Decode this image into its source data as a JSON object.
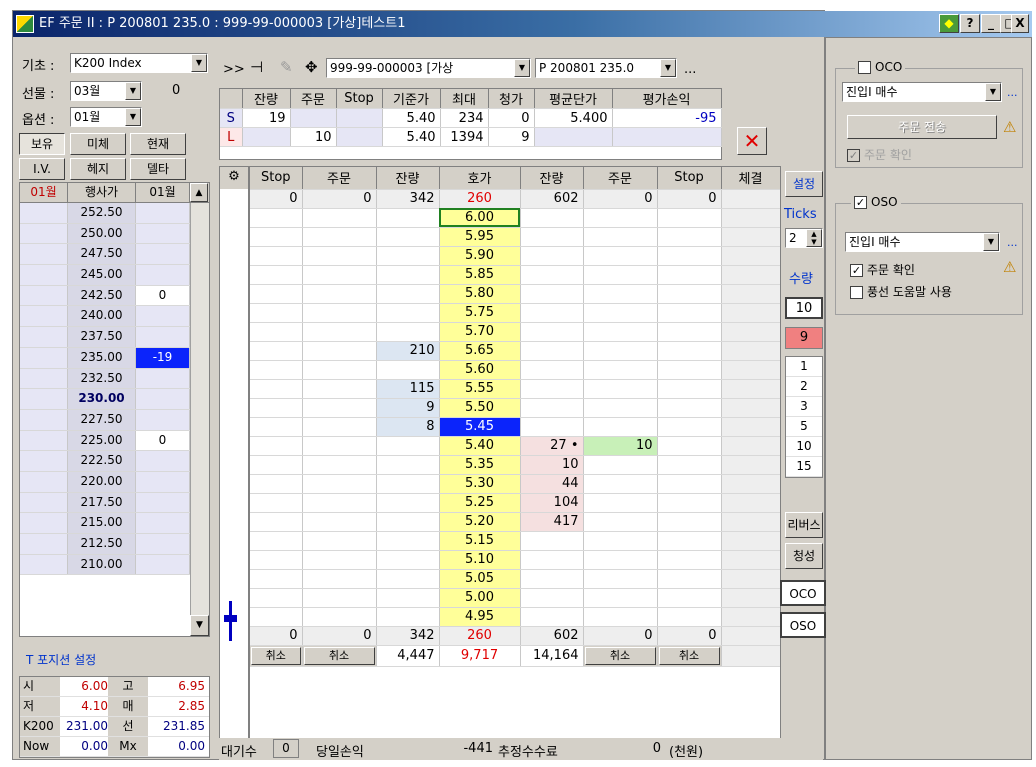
{
  "window": {
    "title": "EF 주문 II : P 200801 235.0 : 999-99-000003 [가상]테스트1",
    "buttons": [
      "?",
      "_",
      "□",
      "X"
    ]
  },
  "left": {
    "base_label": "기초 :",
    "base_value": "K200 Index",
    "futures_label": "선물 :",
    "futures_month": "03월",
    "futures_qty": "0",
    "option_label": "옵션 :",
    "option_month": "01월",
    "tabs1": [
      "보유",
      "미체",
      "현재"
    ],
    "tabs2": [
      "I.V.",
      "헤지",
      "델타"
    ],
    "col_headers": [
      "01월",
      "행사가",
      "01월"
    ],
    "strikes": [
      {
        "k": "252.50",
        "p": ""
      },
      {
        "k": "250.00",
        "p": ""
      },
      {
        "k": "247.50",
        "p": ""
      },
      {
        "k": "245.00",
        "p": ""
      },
      {
        "k": "242.50",
        "p": "0"
      },
      {
        "k": "240.00",
        "p": ""
      },
      {
        "k": "237.50",
        "p": ""
      },
      {
        "k": "235.00",
        "p": "-19"
      },
      {
        "k": "232.50",
        "p": ""
      },
      {
        "k": "230.00",
        "p": ""
      },
      {
        "k": "227.50",
        "p": ""
      },
      {
        "k": "225.00",
        "p": "0"
      },
      {
        "k": "222.50",
        "p": ""
      },
      {
        "k": "220.00",
        "p": ""
      },
      {
        "k": "217.50",
        "p": ""
      },
      {
        "k": "215.00",
        "p": ""
      },
      {
        "k": "212.50",
        "p": ""
      },
      {
        "k": "210.00",
        "p": ""
      }
    ],
    "position_setting": "T 포지션 설정",
    "stats": [
      {
        "a": "시",
        "b": "6.00",
        "c": "고",
        "d": "6.95"
      },
      {
        "a": "저",
        "b": "4.10",
        "c": "매",
        "d": "2.85"
      },
      {
        "a": "K200",
        "b": "231.00",
        "c": "선",
        "d": "231.85"
      },
      {
        "a": "Now",
        "b": "0.00",
        "c": "Mx",
        "d": "0.00"
      }
    ]
  },
  "toolbar": {
    "nav": ">>",
    "account": "999-99-000003 [가상",
    "symbol": "P 200801 235.0",
    "more": "..."
  },
  "summary": {
    "headers": [
      "잔량",
      "주문",
      "Stop",
      "기준가",
      "최대",
      "청가",
      "평균단가",
      "평가손익"
    ],
    "s": {
      "label": "S",
      "remain": "19",
      "order": "",
      "stop": "",
      "base": "5.40",
      "max": "234",
      "clear": "0",
      "avg": "5.400",
      "pl": "-95"
    },
    "l": {
      "label": "L",
      "remain": "",
      "order": "10",
      "stop": "",
      "base": "5.40",
      "max": "1394",
      "clear": "9",
      "avg": "",
      "pl": ""
    }
  },
  "ladder": {
    "headers": [
      "Stop",
      "주문",
      "잔량",
      "호가",
      "잔량",
      "주문",
      "Stop",
      "체결"
    ],
    "top": {
      "stop1": "0",
      "order1": "0",
      "rem1": "342",
      "price": "260",
      "rem2": "602",
      "order2": "0",
      "stop2": "0"
    },
    "rows": [
      {
        "p": "6.00",
        "ask": "",
        "bid": "",
        "ord": ""
      },
      {
        "p": "5.95",
        "ask": "",
        "bid": "",
        "ord": ""
      },
      {
        "p": "5.90",
        "ask": "",
        "bid": "",
        "ord": ""
      },
      {
        "p": "5.85",
        "ask": "",
        "bid": "",
        "ord": ""
      },
      {
        "p": "5.80",
        "ask": "",
        "bid": "",
        "ord": ""
      },
      {
        "p": "5.75",
        "ask": "",
        "bid": "",
        "ord": ""
      },
      {
        "p": "5.70",
        "ask": "",
        "bid": "",
        "ord": ""
      },
      {
        "p": "5.65",
        "ask": "210",
        "bid": "",
        "ord": ""
      },
      {
        "p": "5.60",
        "ask": "",
        "bid": "",
        "ord": ""
      },
      {
        "p": "5.55",
        "ask": "115",
        "bid": "",
        "ord": ""
      },
      {
        "p": "5.50",
        "ask": "9",
        "bid": "",
        "ord": ""
      },
      {
        "p": "5.45",
        "ask": "8",
        "bid": "",
        "ord": ""
      },
      {
        "p": "5.40",
        "ask": "",
        "bid": "27",
        "ord": "10"
      },
      {
        "p": "5.35",
        "ask": "",
        "bid": "10",
        "ord": ""
      },
      {
        "p": "5.30",
        "ask": "",
        "bid": "44",
        "ord": ""
      },
      {
        "p": "5.25",
        "ask": "",
        "bid": "104",
        "ord": ""
      },
      {
        "p": "5.20",
        "ask": "",
        "bid": "417",
        "ord": ""
      },
      {
        "p": "5.15",
        "ask": "",
        "bid": "",
        "ord": ""
      },
      {
        "p": "5.10",
        "ask": "",
        "bid": "",
        "ord": ""
      },
      {
        "p": "5.05",
        "ask": "",
        "bid": "",
        "ord": ""
      },
      {
        "p": "5.00",
        "ask": "",
        "bid": "",
        "ord": ""
      },
      {
        "p": "4.95",
        "ask": "",
        "bid": "",
        "ord": ""
      }
    ],
    "bottom": {
      "stop1": "0",
      "order1": "0",
      "rem1": "342",
      "price": "260",
      "rem2": "602",
      "order2": "0",
      "stop2": "0"
    },
    "bottom2": {
      "cancel": "취소",
      "rem1": "4,447",
      "price": "9,717",
      "rem2": "14,164"
    }
  },
  "side": {
    "setting": "설정",
    "ticks_label": "Ticks",
    "ticks": "2",
    "qty_label": "수량",
    "qty": "10",
    "qty_red": "9",
    "qty_list": [
      "1",
      "2",
      "3",
      "5",
      "10",
      "15"
    ],
    "reverse": "리버스",
    "clear": "청성",
    "oco": "OCO",
    "oso": "OSO"
  },
  "status": {
    "wait_label": "대기수",
    "wait": "0",
    "pl_label": "당일손익",
    "pl": "-441",
    "fee_label": "추정수수료",
    "fee": "0",
    "unit": "(천원)"
  },
  "oco": {
    "title": "OCO",
    "select": "진입I 매수",
    "btn": "주문 전송",
    "confirm": "주문 확인",
    "more": "..."
  },
  "oso": {
    "title": "OSO",
    "select": "진입I 매수",
    "confirm": "주문 확인",
    "balloon": "풍선 도움말 사용",
    "more": "..."
  },
  "colors": {
    "title": "#0a246a",
    "ask_bg": "#dce6f2",
    "bid_bg": "#f5e0e0",
    "price_bg": "#ffff99",
    "selected": "#0b24fb"
  }
}
